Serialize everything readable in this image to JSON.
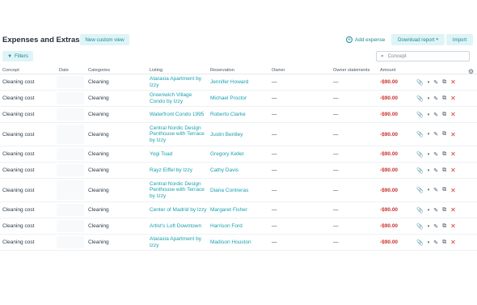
{
  "header": {
    "title": "Expenses and Extras",
    "new_custom_view": "New custom view",
    "add_expense": "Add expense",
    "download_report": "Download report",
    "import": "Import"
  },
  "toolbar": {
    "filters": "Filters",
    "search_placeholder": "Concept"
  },
  "columns": {
    "concept": "Concept",
    "date": "Date",
    "categories": "Categories",
    "listing": "Listing",
    "reservation": "Reservation",
    "owner": "Owner",
    "owner_statements": "Owner statements",
    "amount": "Amount"
  },
  "rows": [
    {
      "concept": "Cleaning cost",
      "category": "Cleaning",
      "listing": "Ataraxia Apartment by Izzy",
      "reservation": "Jennifer Howard",
      "owner": "—",
      "owner_statements": "—",
      "amount": "-$90.00"
    },
    {
      "concept": "Cleaning cost",
      "category": "Cleaning",
      "listing": "Greenwich Village Condo by Izzy",
      "reservation": "Michael Proctor",
      "owner": "—",
      "owner_statements": "—",
      "amount": "-$90.00"
    },
    {
      "concept": "Cleaning cost",
      "category": "Cleaning",
      "listing": "Waterfront Condo 1995",
      "reservation": "Roberto Clarke",
      "owner": "—",
      "owner_statements": "—",
      "amount": "-$90.00"
    },
    {
      "concept": "Cleaning cost",
      "category": "Cleaning",
      "listing": "Central Nordic Design Penthouse with Terrace by Izzy",
      "reservation": "Justin Bentley",
      "owner": "—",
      "owner_statements": "—",
      "amount": "-$90.00"
    },
    {
      "concept": "Cleaning cost",
      "category": "Cleaning",
      "listing": "Yogi Toad",
      "reservation": "Gregory Keller",
      "owner": "—",
      "owner_statements": "—",
      "amount": "-$90.00"
    },
    {
      "concept": "Cleaning cost",
      "category": "Cleaning",
      "listing": "Rayz Eiffel by Izzy",
      "reservation": "Cathy Davis",
      "owner": "—",
      "owner_statements": "—",
      "amount": "-$90.00"
    },
    {
      "concept": "Cleaning cost",
      "category": "Cleaning",
      "listing": "Central Nordic Design Penthouse with Terrace by Izzy",
      "reservation": "Diana Contreras",
      "owner": "—",
      "owner_statements": "—",
      "amount": "-$90.00"
    },
    {
      "concept": "Cleaning cost",
      "category": "Cleaning",
      "listing": "Center of Madrid by Izzy",
      "reservation": "Margaret Fisher",
      "owner": "—",
      "owner_statements": "—",
      "amount": "-$90.00"
    },
    {
      "concept": "Cleaning cost",
      "category": "Cleaning",
      "listing": "Artist's Loft Downtown",
      "reservation": "Harrison Ford",
      "owner": "—",
      "owner_statements": "—",
      "amount": "-$90.00"
    },
    {
      "concept": "Cleaning cost",
      "category": "Cleaning",
      "listing": "Ataraxia Apartment by Izzy",
      "reservation": "Madison Houston",
      "owner": "—",
      "owner_statements": "—",
      "amount": "-$90.00"
    }
  ],
  "icons": {
    "attach": "paperclip-icon",
    "edit": "pencil-icon",
    "duplicate": "copy-icon",
    "delete": "close-icon",
    "settings": "gear-icon"
  },
  "colors": {
    "accent": "#1aa1ae",
    "accent_bg": "#dff4f6",
    "negative_amount": "#c9302c",
    "delete": "#d23a2f"
  }
}
